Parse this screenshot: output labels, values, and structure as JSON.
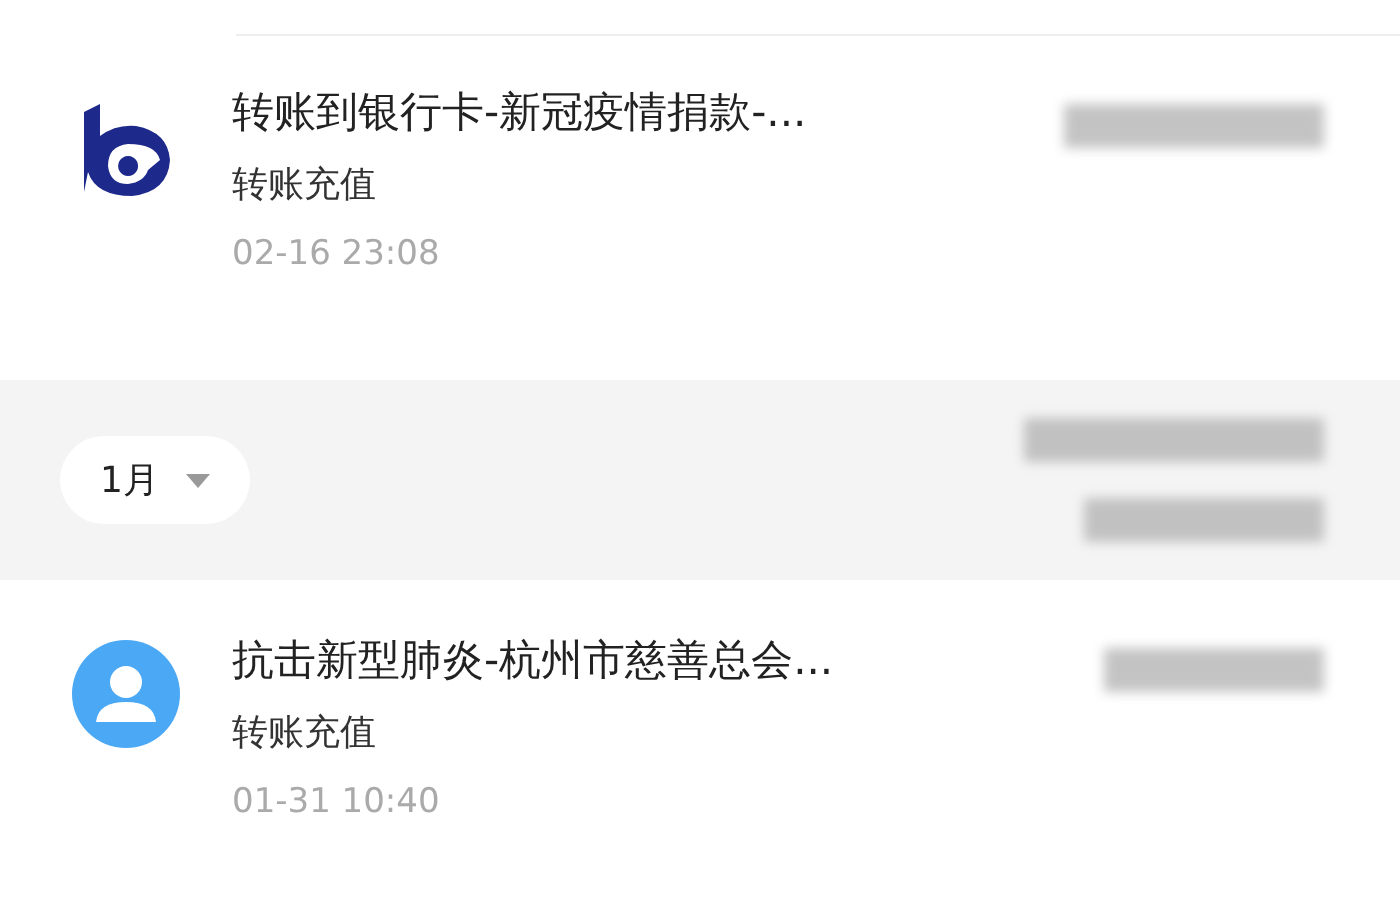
{
  "transactions_before": [
    {
      "icon": {
        "kind": "bank-logo"
      },
      "title": "转账到银行卡-新冠疫情捐款-...",
      "category": "转账充值",
      "time": "02-16  23:08"
    }
  ],
  "month_header": {
    "label": "1月"
  },
  "transactions_after": [
    {
      "icon": {
        "kind": "avatar"
      },
      "title": "抗击新型肺炎-杭州市慈善总会...",
      "category": "转账充值",
      "time": "01-31  10:40"
    }
  ]
}
